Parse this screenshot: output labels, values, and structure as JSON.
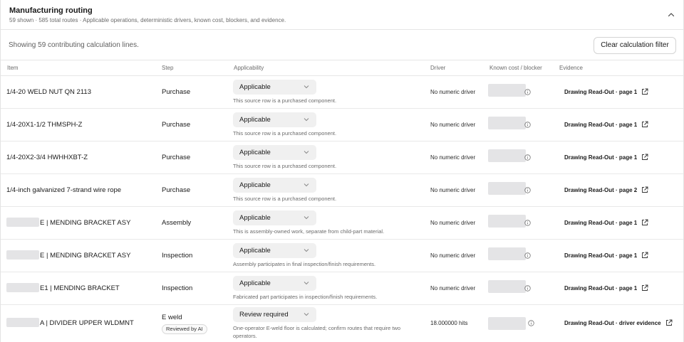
{
  "header": {
    "title": "Manufacturing routing",
    "subtitle": "59 shown · 585 total routes · Applicable operations, deterministic drivers, known cost, blockers, and evidence."
  },
  "toolbar": {
    "showing_text": "Showing 59 contributing calculation lines.",
    "clear_button": "Clear calculation filter"
  },
  "columns": {
    "item": "Item",
    "step": "Step",
    "applicability": "Applicability",
    "driver": "Driver",
    "cost": "Known cost / blocker",
    "evidence": "Evidence"
  },
  "rows": [
    {
      "item": "1/4-20 WELD NUT QN 2113",
      "step": "Purchase",
      "applicability": "Applicable",
      "note": "This source row is a purchased component.",
      "driver": "No numeric driver",
      "evidence": "Drawing Read-Out · page 1"
    },
    {
      "item": "1/4-20X1-1/2 THMSPH-Z",
      "step": "Purchase",
      "applicability": "Applicable",
      "note": "This source row is a purchased component.",
      "driver": "No numeric driver",
      "evidence": "Drawing Read-Out · page 1"
    },
    {
      "item": "1/4-20X2-3/4 HWHHXBT-Z",
      "step": "Purchase",
      "applicability": "Applicable",
      "note": "This source row is a purchased component.",
      "driver": "No numeric driver",
      "evidence": "Drawing Read-Out · page 1"
    },
    {
      "item": "1/4-inch galvanized 7-strand wire rope",
      "step": "Purchase",
      "applicability": "Applicable",
      "note": "This source row is a purchased component.",
      "driver": "No numeric driver",
      "evidence": "Drawing Read-Out · page 2"
    },
    {
      "item": "E | MENDING BRACKET ASY",
      "step": "Assembly",
      "applicability": "Applicable",
      "note": "This is assembly-owned work, separate from child-part material.",
      "driver": "No numeric driver",
      "evidence": "Drawing Read-Out · page 1"
    },
    {
      "item": "E | MENDING BRACKET ASY",
      "step": "Inspection",
      "applicability": "Applicable",
      "note": "Assembly participates in final inspection/finish requirements.",
      "driver": "No numeric driver",
      "evidence": "Drawing Read-Out · page 1"
    },
    {
      "item": "E1 | MENDING BRACKET",
      "step": "Inspection",
      "applicability": "Applicable",
      "note": "Fabricated part participates in inspection/finish requirements.",
      "driver": "No numeric driver",
      "evidence": "Drawing Read-Out · page 1"
    },
    {
      "item": "A | DIVIDER UPPER WLDMNT",
      "step": "E weld",
      "badge": "Reviewed by AI",
      "applicability": "Review required",
      "note": "One-operator E-weld floor is calculated; confirm routes that require two operators.",
      "driver": "18.000000 hits",
      "evidence": "Drawing Read-Out · driver evidence"
    }
  ]
}
